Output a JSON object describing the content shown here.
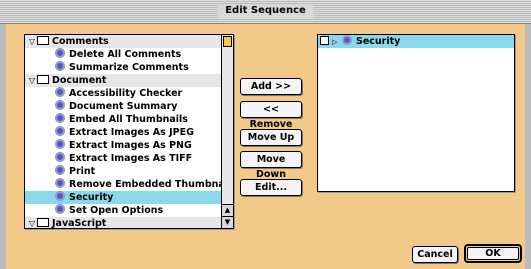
{
  "window": {
    "title": "Edit Sequence"
  },
  "left_list": {
    "rows": [
      {
        "type": "group",
        "label": "Comments",
        "expanded": true
      },
      {
        "type": "child",
        "label": "Delete All Comments"
      },
      {
        "type": "child",
        "label": "Summarize Comments"
      },
      {
        "type": "group",
        "label": "Document",
        "expanded": true
      },
      {
        "type": "child",
        "label": "Accessibility Checker"
      },
      {
        "type": "child",
        "label": "Document Summary"
      },
      {
        "type": "child",
        "label": "Embed All Thumbnails"
      },
      {
        "type": "child",
        "label": "Extract Images As JPEG"
      },
      {
        "type": "child",
        "label": "Extract Images As PNG"
      },
      {
        "type": "child",
        "label": "Extract Images As TIFF"
      },
      {
        "type": "child",
        "label": "Print"
      },
      {
        "type": "child",
        "label": "Remove Embedded Thumbna"
      },
      {
        "type": "child",
        "label": "Security",
        "selected": true
      },
      {
        "type": "child",
        "label": "Set Open Options"
      },
      {
        "type": "group",
        "label": "JavaScript",
        "expanded": true
      }
    ]
  },
  "buttons": {
    "add": "Add >>",
    "remove": "<< Remove",
    "move_up": "Move Up",
    "move_down": "Move Down",
    "edit": "Edit..."
  },
  "sequence_list": {
    "rows": [
      {
        "label": "Security",
        "checked": false
      }
    ]
  },
  "footer": {
    "cancel": "Cancel",
    "ok": "OK"
  }
}
